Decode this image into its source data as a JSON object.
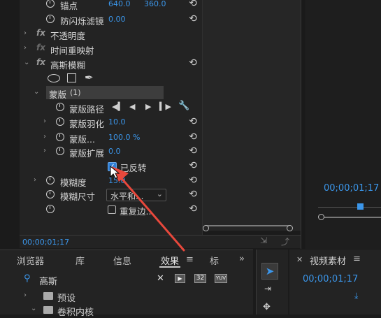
{
  "effect_controls": {
    "anchor": {
      "label": "锚点",
      "x": "640.0",
      "y": "360.0"
    },
    "anti_flicker": {
      "label": "防闪烁滤镜",
      "value": "0.00"
    },
    "opacity": {
      "label": "不透明度"
    },
    "time_remap": {
      "label": "时间重映射"
    },
    "gaussian_blur": {
      "label": "高斯模糊"
    },
    "mask": {
      "label": "蒙版",
      "count": "(1)"
    },
    "mask_path": {
      "label": "蒙版路径"
    },
    "mask_feather": {
      "label": "蒙版羽化",
      "value": "10.0"
    },
    "mask_opacity": {
      "label": "蒙版...",
      "value": "100.0 %"
    },
    "mask_expansion": {
      "label": "蒙版扩展",
      "value": "0.0"
    },
    "inverted": {
      "label": "已反转"
    },
    "blurriness": {
      "label": "模糊度",
      "value": "15.0"
    },
    "blur_dimensions": {
      "label": "模糊尺寸",
      "value": "水平和..."
    },
    "repeat_edge": {
      "label": "重复边..."
    },
    "timecode": "00;00;01;17"
  },
  "program_monitor": {
    "timecode": "00;00;01;17"
  },
  "bottom_panel": {
    "tabs": [
      "浏览器",
      "库",
      "信息",
      "效果",
      "标记"
    ],
    "search_value": "高斯",
    "badge_32": "32",
    "badge_yuv": "YUV",
    "tree": [
      "预设",
      "卷积内核"
    ]
  },
  "source_panel": {
    "title": "视频素材",
    "timecode": "00;00;01;17"
  },
  "colors": {
    "accent": "#3b96ea",
    "arrow": "#e8483c",
    "bg": "#1b1b1b"
  }
}
